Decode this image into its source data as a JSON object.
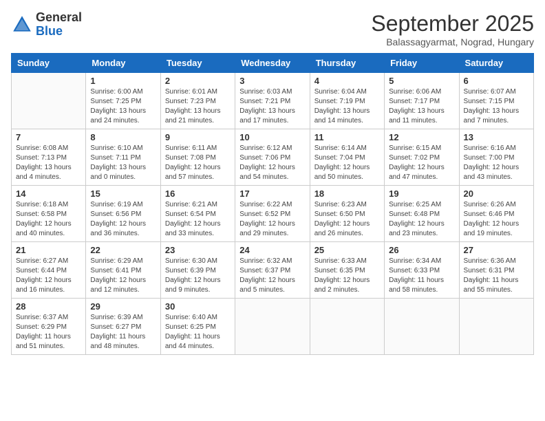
{
  "logo": {
    "general": "General",
    "blue": "Blue"
  },
  "header": {
    "month": "September 2025",
    "location": "Balassagyarmat, Nograd, Hungary"
  },
  "weekdays": [
    "Sunday",
    "Monday",
    "Tuesday",
    "Wednesday",
    "Thursday",
    "Friday",
    "Saturday"
  ],
  "weeks": [
    [
      {
        "day": "",
        "sunrise": "",
        "sunset": "",
        "daylight": ""
      },
      {
        "day": "1",
        "sunrise": "Sunrise: 6:00 AM",
        "sunset": "Sunset: 7:25 PM",
        "daylight": "Daylight: 13 hours and 24 minutes."
      },
      {
        "day": "2",
        "sunrise": "Sunrise: 6:01 AM",
        "sunset": "Sunset: 7:23 PM",
        "daylight": "Daylight: 13 hours and 21 minutes."
      },
      {
        "day": "3",
        "sunrise": "Sunrise: 6:03 AM",
        "sunset": "Sunset: 7:21 PM",
        "daylight": "Daylight: 13 hours and 17 minutes."
      },
      {
        "day": "4",
        "sunrise": "Sunrise: 6:04 AM",
        "sunset": "Sunset: 7:19 PM",
        "daylight": "Daylight: 13 hours and 14 minutes."
      },
      {
        "day": "5",
        "sunrise": "Sunrise: 6:06 AM",
        "sunset": "Sunset: 7:17 PM",
        "daylight": "Daylight: 13 hours and 11 minutes."
      },
      {
        "day": "6",
        "sunrise": "Sunrise: 6:07 AM",
        "sunset": "Sunset: 7:15 PM",
        "daylight": "Daylight: 13 hours and 7 minutes."
      }
    ],
    [
      {
        "day": "7",
        "sunrise": "Sunrise: 6:08 AM",
        "sunset": "Sunset: 7:13 PM",
        "daylight": "Daylight: 13 hours and 4 minutes."
      },
      {
        "day": "8",
        "sunrise": "Sunrise: 6:10 AM",
        "sunset": "Sunset: 7:11 PM",
        "daylight": "Daylight: 13 hours and 0 minutes."
      },
      {
        "day": "9",
        "sunrise": "Sunrise: 6:11 AM",
        "sunset": "Sunset: 7:08 PM",
        "daylight": "Daylight: 12 hours and 57 minutes."
      },
      {
        "day": "10",
        "sunrise": "Sunrise: 6:12 AM",
        "sunset": "Sunset: 7:06 PM",
        "daylight": "Daylight: 12 hours and 54 minutes."
      },
      {
        "day": "11",
        "sunrise": "Sunrise: 6:14 AM",
        "sunset": "Sunset: 7:04 PM",
        "daylight": "Daylight: 12 hours and 50 minutes."
      },
      {
        "day": "12",
        "sunrise": "Sunrise: 6:15 AM",
        "sunset": "Sunset: 7:02 PM",
        "daylight": "Daylight: 12 hours and 47 minutes."
      },
      {
        "day": "13",
        "sunrise": "Sunrise: 6:16 AM",
        "sunset": "Sunset: 7:00 PM",
        "daylight": "Daylight: 12 hours and 43 minutes."
      }
    ],
    [
      {
        "day": "14",
        "sunrise": "Sunrise: 6:18 AM",
        "sunset": "Sunset: 6:58 PM",
        "daylight": "Daylight: 12 hours and 40 minutes."
      },
      {
        "day": "15",
        "sunrise": "Sunrise: 6:19 AM",
        "sunset": "Sunset: 6:56 PM",
        "daylight": "Daylight: 12 hours and 36 minutes."
      },
      {
        "day": "16",
        "sunrise": "Sunrise: 6:21 AM",
        "sunset": "Sunset: 6:54 PM",
        "daylight": "Daylight: 12 hours and 33 minutes."
      },
      {
        "day": "17",
        "sunrise": "Sunrise: 6:22 AM",
        "sunset": "Sunset: 6:52 PM",
        "daylight": "Daylight: 12 hours and 29 minutes."
      },
      {
        "day": "18",
        "sunrise": "Sunrise: 6:23 AM",
        "sunset": "Sunset: 6:50 PM",
        "daylight": "Daylight: 12 hours and 26 minutes."
      },
      {
        "day": "19",
        "sunrise": "Sunrise: 6:25 AM",
        "sunset": "Sunset: 6:48 PM",
        "daylight": "Daylight: 12 hours and 23 minutes."
      },
      {
        "day": "20",
        "sunrise": "Sunrise: 6:26 AM",
        "sunset": "Sunset: 6:46 PM",
        "daylight": "Daylight: 12 hours and 19 minutes."
      }
    ],
    [
      {
        "day": "21",
        "sunrise": "Sunrise: 6:27 AM",
        "sunset": "Sunset: 6:44 PM",
        "daylight": "Daylight: 12 hours and 16 minutes."
      },
      {
        "day": "22",
        "sunrise": "Sunrise: 6:29 AM",
        "sunset": "Sunset: 6:41 PM",
        "daylight": "Daylight: 12 hours and 12 minutes."
      },
      {
        "day": "23",
        "sunrise": "Sunrise: 6:30 AM",
        "sunset": "Sunset: 6:39 PM",
        "daylight": "Daylight: 12 hours and 9 minutes."
      },
      {
        "day": "24",
        "sunrise": "Sunrise: 6:32 AM",
        "sunset": "Sunset: 6:37 PM",
        "daylight": "Daylight: 12 hours and 5 minutes."
      },
      {
        "day": "25",
        "sunrise": "Sunrise: 6:33 AM",
        "sunset": "Sunset: 6:35 PM",
        "daylight": "Daylight: 12 hours and 2 minutes."
      },
      {
        "day": "26",
        "sunrise": "Sunrise: 6:34 AM",
        "sunset": "Sunset: 6:33 PM",
        "daylight": "Daylight: 11 hours and 58 minutes."
      },
      {
        "day": "27",
        "sunrise": "Sunrise: 6:36 AM",
        "sunset": "Sunset: 6:31 PM",
        "daylight": "Daylight: 11 hours and 55 minutes."
      }
    ],
    [
      {
        "day": "28",
        "sunrise": "Sunrise: 6:37 AM",
        "sunset": "Sunset: 6:29 PM",
        "daylight": "Daylight: 11 hours and 51 minutes."
      },
      {
        "day": "29",
        "sunrise": "Sunrise: 6:39 AM",
        "sunset": "Sunset: 6:27 PM",
        "daylight": "Daylight: 11 hours and 48 minutes."
      },
      {
        "day": "30",
        "sunrise": "Sunrise: 6:40 AM",
        "sunset": "Sunset: 6:25 PM",
        "daylight": "Daylight: 11 hours and 44 minutes."
      },
      {
        "day": "",
        "sunrise": "",
        "sunset": "",
        "daylight": ""
      },
      {
        "day": "",
        "sunrise": "",
        "sunset": "",
        "daylight": ""
      },
      {
        "day": "",
        "sunrise": "",
        "sunset": "",
        "daylight": ""
      },
      {
        "day": "",
        "sunrise": "",
        "sunset": "",
        "daylight": ""
      }
    ]
  ]
}
